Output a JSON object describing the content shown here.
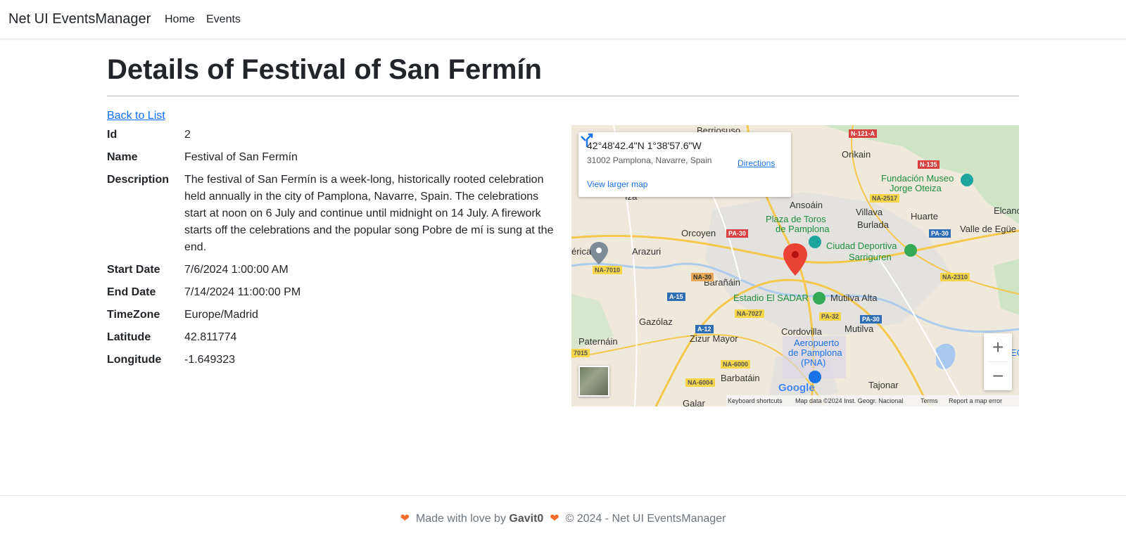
{
  "nav": {
    "brand": "Net UI EventsManager",
    "items": [
      {
        "label": "Home"
      },
      {
        "label": "Events"
      }
    ]
  },
  "page": {
    "title": "Details of Festival of San Fermín",
    "back_link": "Back to List"
  },
  "details": [
    {
      "label": "Id",
      "value": "2"
    },
    {
      "label": "Name",
      "value": "Festival of San Fermín"
    },
    {
      "label": "Description",
      "value": "The festival of San Fermín is a week-long, historically rooted celebration held annually in the city of Pamplona, Navarre, Spain. The celebrations start at noon on 6 July and continue until midnight on 14 July. A firework starts off the celebrations and the popular song Pobre de mí is sung at the end."
    },
    {
      "label": "Start Date",
      "value": "7/6/2024 1:00:00 AM"
    },
    {
      "label": "End Date",
      "value": "7/14/2024 11:00:00 PM"
    },
    {
      "label": "TimeZone",
      "value": "Europe/Madrid"
    },
    {
      "label": "Latitude",
      "value": "42.811774"
    },
    {
      "label": "Longitude",
      "value": "-1.649323"
    }
  ],
  "map": {
    "coords": "42°48'42.4\"N 1°38'57.6\"W",
    "address": "31002 Pamplona, Navarre, Spain",
    "directions": "Directions",
    "larger_map": "View larger map",
    "zoom_in": "+",
    "zoom_out": "−",
    "google": "Google",
    "footer": {
      "shortcuts": "Keyboard shortcuts",
      "data": "Map data ©2024 Inst. Geogr. Nacional",
      "terms": "Terms",
      "report": "Report a map error"
    },
    "labels": {
      "berriosuso": "Berriosuso",
      "orikain": "Orikain",
      "fundacion": "Fundación Museo",
      "jorge": "Jorge Oteiza",
      "ansoain": "Ansoáin",
      "villava": "Villava",
      "huarte": "Huarte",
      "elcano": "Elcanc",
      "plaza1": "Plaza de Toros",
      "plaza2": "de Pamplona",
      "burlada": "Burlada",
      "valle": "Valle de Egüe",
      "orcoyen": "Orcoyen",
      "ciudad1": "Ciudad Deportiva",
      "ciudad2": "Sarriguren",
      "arazuri": "Arazuri",
      "erica": "érica",
      "baranain": "Barañáin",
      "mutilva_alta": "Mutilva Alta",
      "estadio": "Estadio El SADAR",
      "gazolaz": "Gazólaz",
      "cordovilla": "Cordovilla",
      "mutilva": "Mutilva",
      "paternain": "Paternáin",
      "zizur": "Zizur Mayor",
      "aero1": "Aeropuerto",
      "aero2": "de Pamplona",
      "aero3": "(PNA)",
      "barbatain": "Barbatáin",
      "tajonar": "Tajonar",
      "galar": "Galar",
      "iza": "Iza",
      "eg": "EG"
    },
    "roads": {
      "n121a": "N-121-A",
      "n135": "N-135",
      "na2517": "NA-2517",
      "pa30a": "PA-30",
      "pa30b": "PA-30",
      "pa30c": "PA-30",
      "na2310": "NA-2310",
      "na7010": "NA-7010",
      "na30": "NA-30",
      "a15": "A-15",
      "na7027": "NA-7027",
      "pa32": "PA-32",
      "a12": "A-12",
      "r7015": "7015",
      "na6000": "NA-6000",
      "na6004": "NA-6004"
    }
  },
  "footer": {
    "made_with": "Made with love by",
    "author": "Gavit0",
    "copyright": "© 2024 - Net UI EventsManager"
  }
}
